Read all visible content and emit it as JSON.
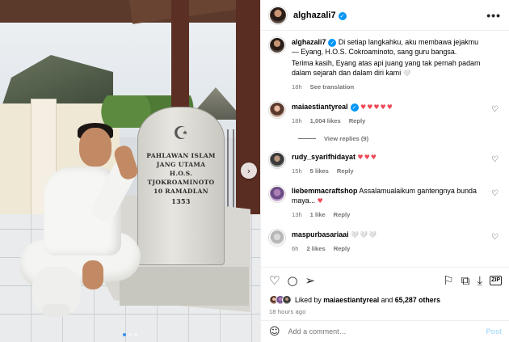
{
  "author": {
    "username": "alghazali7",
    "verified_mark": "✓"
  },
  "header": {
    "more_icon": "•••"
  },
  "media": {
    "stone_lines": [
      "PAHLAWAN ISLAM",
      "JANG UTAMA",
      "H.O.S.",
      "TJOKROAMINOTO",
      "10 RAMADLAN"
    ],
    "stone_year": "1353",
    "next_icon": "›",
    "carousel_dots": 3,
    "active_dot": 0
  },
  "caption": {
    "username": "alghazali7",
    "line1": "Di setiap langkahku, aku membawa jejakmu — Eyang, H.O.S. Cokroaminoto, sang guru bangsa.",
    "line2": "Terima kasih, Eyang atas api juang yang tak pernah padam dalam sejarah dan dalam diri kami",
    "end_emoji": "🤍",
    "time": "18h",
    "translation": "See translation"
  },
  "comments": [
    {
      "username": "maiaestiantyreal",
      "verified": true,
      "text": "♥♥♥♥♥",
      "text_kind": "hearts",
      "time": "18h",
      "likes": "1,004 likes",
      "reply": "Reply"
    },
    {
      "username": "rudy_syarifhidayat",
      "verified": false,
      "text": "♥♥♥",
      "text_kind": "hearts",
      "time": "15h",
      "likes": "5 likes",
      "reply": "Reply"
    },
    {
      "username": "liebemmacraftshop",
      "verified": false,
      "text": "Assalamualaikum gantengnya bunda maya...",
      "end": "♥",
      "time": "13h",
      "likes": "1 like",
      "reply": "Reply"
    },
    {
      "username": "maspurbasariaai",
      "verified": false,
      "text": "🤍🤍🤍",
      "text_kind": "pale",
      "time": "6h",
      "likes": "2 likes",
      "reply": "Reply"
    }
  ],
  "view_replies": "View replies (9)",
  "actions": {
    "like_icon": "♡",
    "comment_icon": "○",
    "share_icon": "➢",
    "save_icon": "⚐",
    "zip_label": "ZIP"
  },
  "likes_summary": {
    "prefix": "Liked by ",
    "user": "maiaestiantyreal",
    "mid": " and ",
    "count": "65,287 others"
  },
  "posted_ago": "18 hours ago",
  "add_comment": {
    "placeholder": "Add a comment…",
    "post_label": "Post",
    "emoji_icon": "☺"
  }
}
